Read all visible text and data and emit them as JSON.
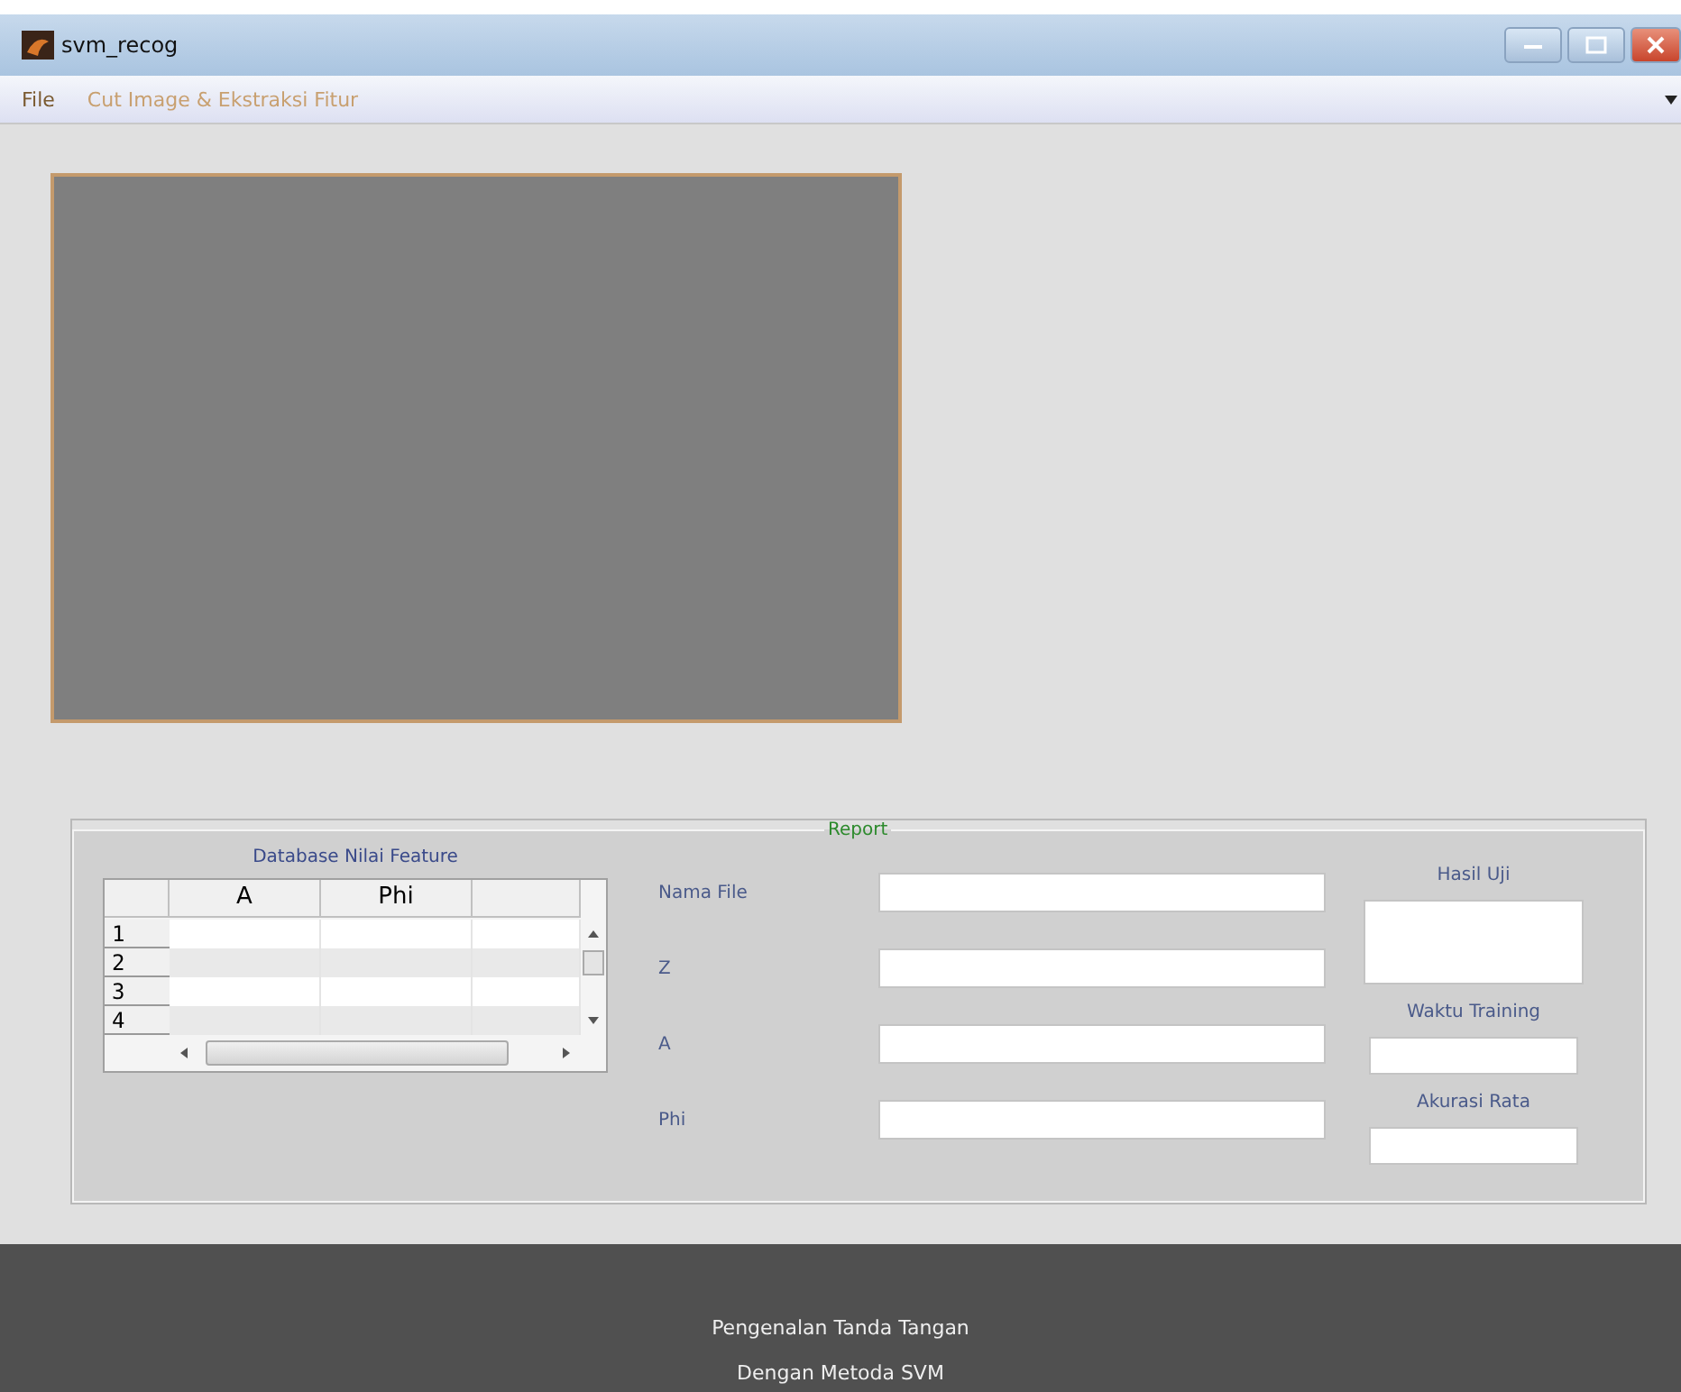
{
  "window": {
    "title": "svm_recog"
  },
  "menu": [
    "File",
    "Cut Image & Ekstraksi Fitur"
  ],
  "report": {
    "title": "Report",
    "table": {
      "title": "Database Nilai Feature",
      "columns": [
        "A",
        "Phi"
      ],
      "row_numbers": [
        "1",
        "2",
        "3",
        "4"
      ]
    },
    "fields": [
      {
        "label": "Nama File"
      },
      {
        "label": "Z"
      },
      {
        "label": "A"
      },
      {
        "label": "Phi"
      }
    ],
    "results": [
      {
        "label": "Hasil Uji",
        "kind": "large"
      },
      {
        "label": "Waktu Training",
        "kind": "small"
      },
      {
        "label": "Akurasi Rata",
        "kind": "small"
      }
    ]
  },
  "footer": [
    "Pengenalan Tanda Tangan",
    "Dengan Metoda SVM"
  ]
}
